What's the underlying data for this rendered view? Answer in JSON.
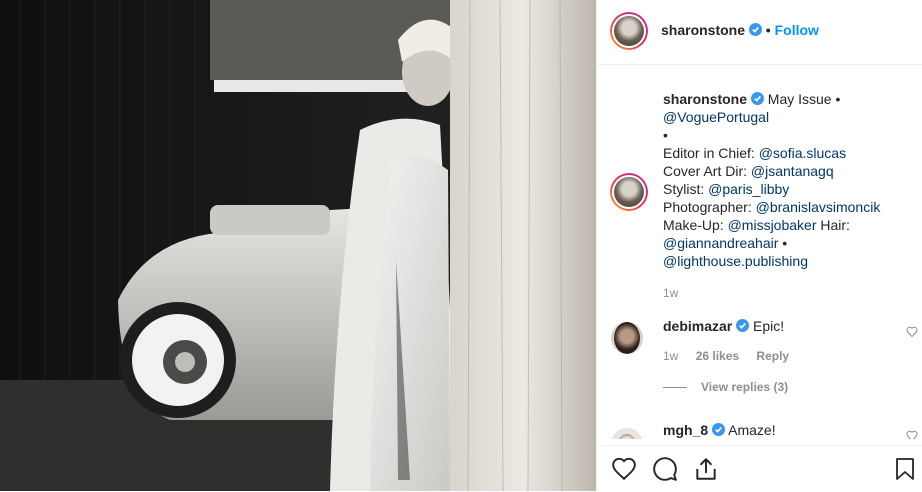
{
  "post": {
    "author": "sharonstone",
    "follow_separator": "•",
    "follow_label": "Follow",
    "caption_user": "sharonstone",
    "caption_lines": [
      {
        "text": "May Issue •",
        "link": ""
      },
      {
        "text": "",
        "link": "@VoguePortugal"
      },
      {
        "text": "•",
        "link": ""
      },
      {
        "text": "Editor in Chief: ",
        "link": "@sofia.slucas"
      },
      {
        "text": "Cover Art Dir: ",
        "link": "@jsantanagq"
      },
      {
        "text": "Stylist: ",
        "link": "@paris_libby"
      },
      {
        "text": "Photographer: ",
        "link": "@branislavsimoncik"
      },
      {
        "text": "Make-Up: ",
        "link": "@missjobaker",
        "after": " Hair:"
      },
      {
        "text": "",
        "link": "@giannandreahair",
        "after": " •"
      },
      {
        "text": "",
        "link": "@lighthouse.publishing"
      }
    ],
    "caption_time": "1w"
  },
  "comments": [
    {
      "user": "debimazar",
      "text": "Epic!",
      "time": "1w",
      "likes": "26 likes",
      "reply": "Reply",
      "view_replies": "View replies (3)"
    },
    {
      "user": "mgh_8",
      "text": "Amaze!"
    }
  ],
  "icons": [
    "heart-icon",
    "comment-icon",
    "share-icon",
    "bookmark-icon",
    "verified-icon"
  ],
  "colors": {
    "follow": "#0095f6",
    "link": "#00376b",
    "meta": "#8e8e8e",
    "verified": "#3897f0"
  }
}
